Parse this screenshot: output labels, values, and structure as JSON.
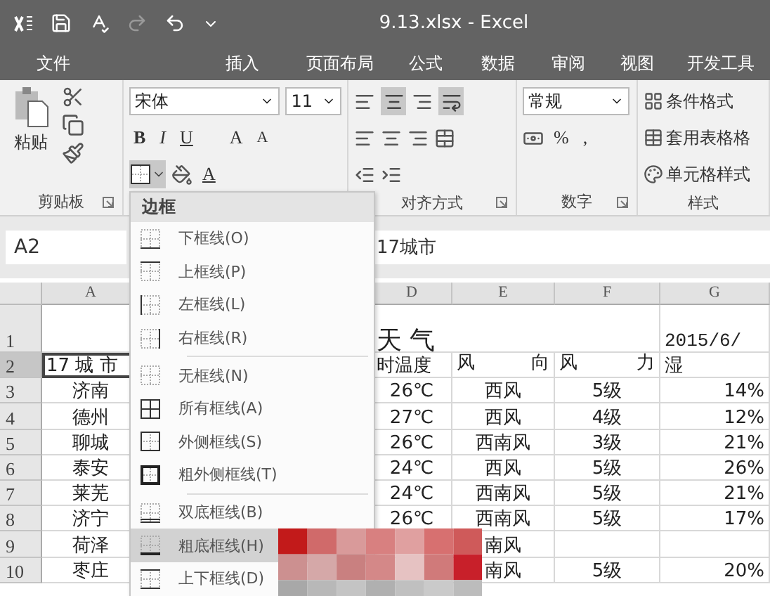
{
  "window": {
    "title": "9.13.xlsx - Excel"
  },
  "tabs": [
    {
      "label": "文件",
      "selected": false
    },
    {
      "label": "插入",
      "selected": false
    },
    {
      "label": "页面布局",
      "selected": false
    },
    {
      "label": "公式",
      "selected": false
    },
    {
      "label": "数据",
      "selected": false
    },
    {
      "label": "审阅",
      "selected": false
    },
    {
      "label": "视图",
      "selected": false
    },
    {
      "label": "开发工具",
      "selected": false
    }
  ],
  "ribbon": {
    "clipboard": {
      "paste": "粘贴",
      "label": "剪贴板"
    },
    "font": {
      "name": "宋体",
      "size": "11",
      "style_buttons": [
        "B",
        "I",
        "U"
      ],
      "grow": "A",
      "shrink": "A",
      "font_color": "A"
    },
    "alignment": {
      "label": "对齐方式"
    },
    "number": {
      "format": "常规",
      "percent": "%",
      "comma": ",",
      "label": "数字"
    },
    "styles": {
      "items": [
        "条件格式",
        "套用表格格",
        "单元格样式"
      ],
      "label": "样式"
    }
  },
  "name_box": "A2",
  "formula": "17城市",
  "columns": [
    "A",
    "D",
    "E",
    "F",
    "G"
  ],
  "rows": [
    {
      "num": "1",
      "title": "天  气",
      "date": "2015/6/"
    },
    {
      "num": "2",
      "selected": true,
      "city": "17 城 市",
      "temp": "时温度",
      "wind": "风 向",
      "level": "风 力",
      "humidity": "湿"
    },
    {
      "num": "3",
      "city": "济南",
      "temp": "26℃",
      "wind": "西风",
      "level": "5级",
      "humidity": "14%"
    },
    {
      "num": "4",
      "city": "德州",
      "temp": "27℃",
      "wind": "西风",
      "level": "4级",
      "humidity": "12%"
    },
    {
      "num": "5",
      "city": "聊城",
      "temp": "26℃",
      "wind": "西南风",
      "level": "3级",
      "humidity": "21%"
    },
    {
      "num": "6",
      "city": "泰安",
      "temp": "24℃",
      "wind": "西风",
      "level": "5级",
      "humidity": "26%"
    },
    {
      "num": "7",
      "city": "莱芜",
      "temp": "24℃",
      "wind": "西南风",
      "level": "5级",
      "humidity": "21%"
    },
    {
      "num": "8",
      "city": "济宁",
      "temp": "26℃",
      "wind": "西南风",
      "level": "5级",
      "humidity": "17%"
    },
    {
      "num": "9",
      "city": "荷泽",
      "wind": "南风"
    },
    {
      "num": "10",
      "city": "枣庄",
      "wind": "南风",
      "level": "5级",
      "humidity": "20%"
    }
  ],
  "border_menu": {
    "title": "边框",
    "groups": [
      [
        {
          "label": "下框线(O)",
          "kind": "bottom",
          "selected": false
        },
        {
          "label": "上框线(P)",
          "kind": "top",
          "selected": false
        },
        {
          "label": "左框线(L)",
          "kind": "left",
          "selected": false
        },
        {
          "label": "右框线(R)",
          "kind": "right",
          "selected": false
        }
      ],
      [
        {
          "label": "无框线(N)",
          "kind": "none",
          "selected": false
        },
        {
          "label": "所有框线(A)",
          "kind": "all",
          "selected": false
        },
        {
          "label": "外侧框线(S)",
          "kind": "outside",
          "selected": false
        },
        {
          "label": "粗外侧框线(T)",
          "kind": "thick_outside",
          "selected": false
        }
      ],
      [
        {
          "label": "双底框线(B)",
          "kind": "double_bottom",
          "selected": false
        },
        {
          "label": "粗底框线(H)",
          "kind": "thick_bottom",
          "selected": true
        },
        {
          "label": "上下框线(D)",
          "kind": "top_bottom",
          "selected": false
        }
      ]
    ]
  }
}
